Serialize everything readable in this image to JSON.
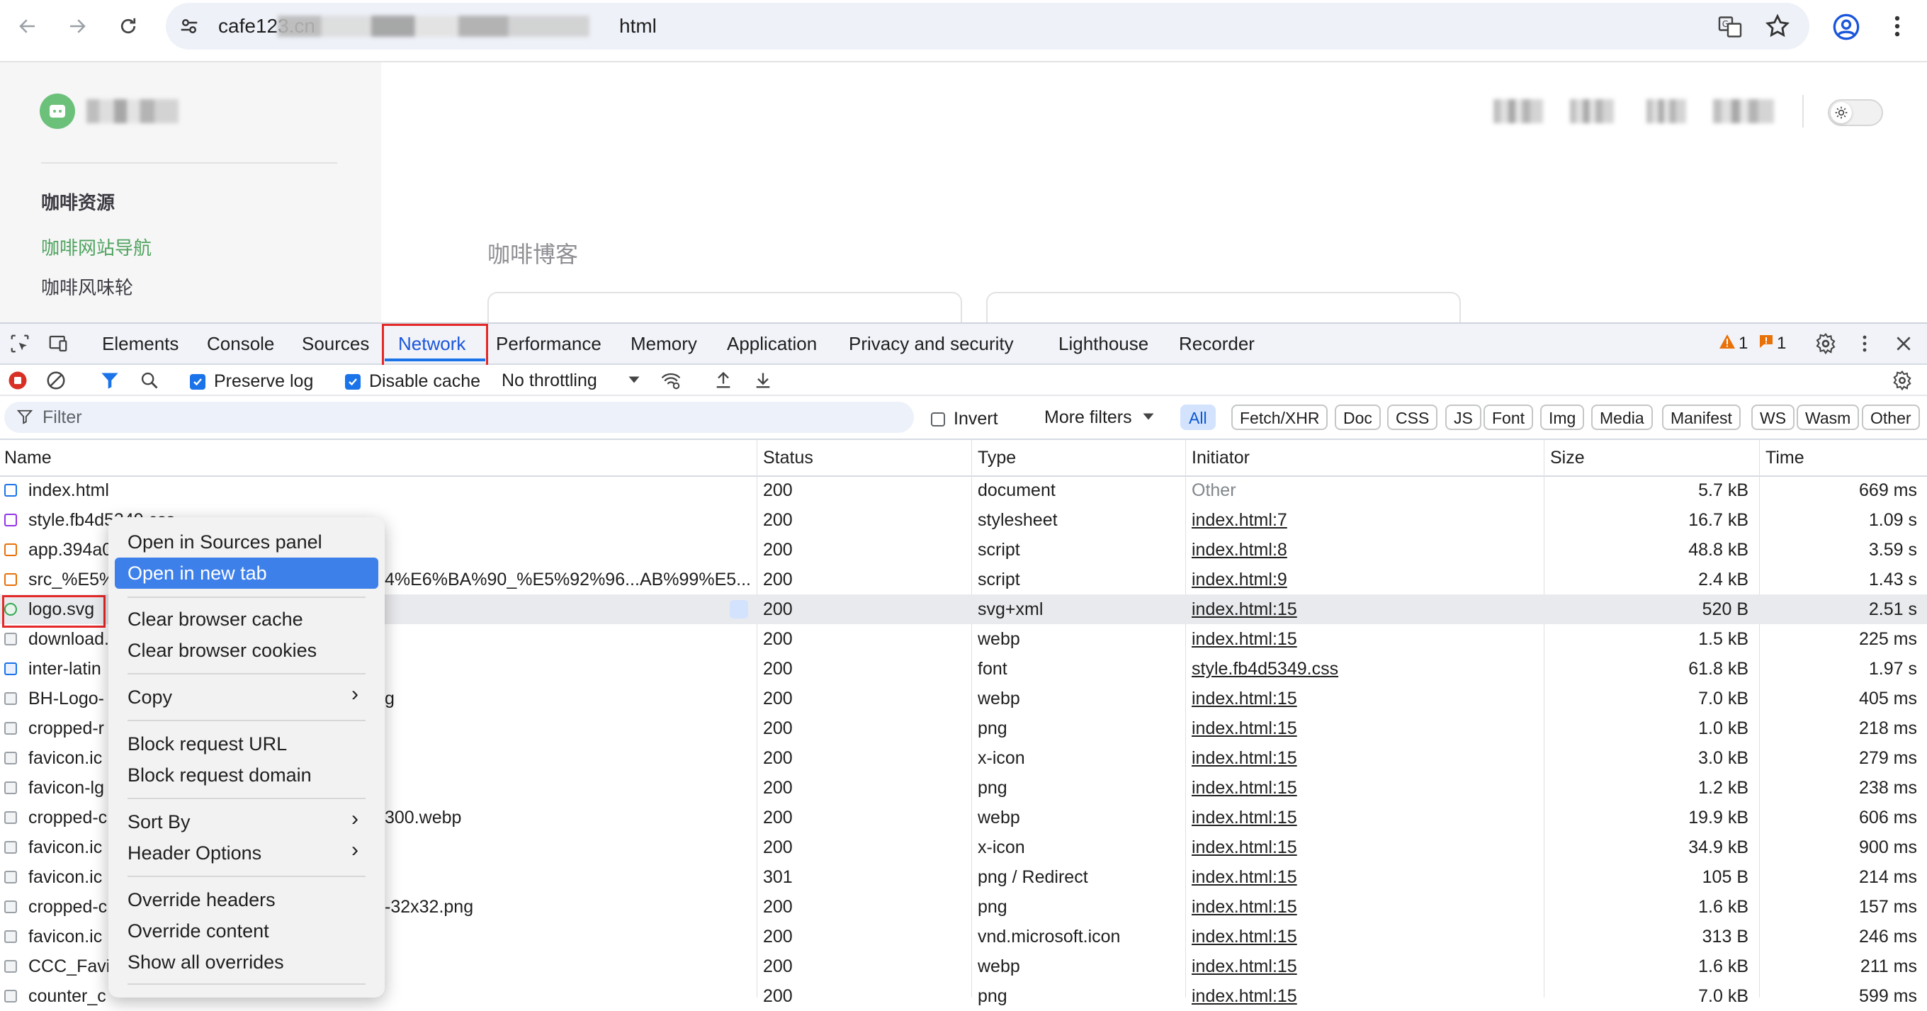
{
  "browser": {
    "url_prefix": "cafe123.cn",
    "url_suffix": "html",
    "icons": [
      "back-icon",
      "forward-icon",
      "reload-icon",
      "site-info-icon",
      "translate-icon",
      "bookmark-star-icon",
      "profile-icon",
      "more-menu-icon"
    ]
  },
  "page": {
    "section_title": "咖啡资源",
    "side_links": [
      "咖啡网站导航",
      "咖啡风味轮"
    ],
    "blog_heading": "咖啡博客"
  },
  "devtools": {
    "tabs": [
      "Elements",
      "Console",
      "Sources",
      "Network",
      "Performance",
      "Memory",
      "Application",
      "Privacy and security",
      "Lighthouse",
      "Recorder"
    ],
    "active_tab": "Network",
    "warning_count": "1",
    "issue_count": "1",
    "toolbar": {
      "preserve_log": "Preserve log",
      "disable_cache": "Disable cache",
      "throttling": "No throttling"
    },
    "filter": {
      "placeholder": "Filter",
      "invert": "Invert",
      "more_filters": "More filters",
      "chips": [
        "All",
        "Fetch/XHR",
        "Doc",
        "CSS",
        "JS",
        "Font",
        "Img",
        "Media",
        "Manifest",
        "WS",
        "Wasm",
        "Other"
      ]
    },
    "columns": [
      "Name",
      "Status",
      "Type",
      "Initiator",
      "Size",
      "Time"
    ],
    "rows": [
      {
        "name": "index.html",
        "status": "200",
        "type": "document",
        "initiator": "Other",
        "size": "5.7 kB",
        "time": "669 ms",
        "icon": "doc",
        "other": true
      },
      {
        "name": "style.fb4d5349.css",
        "status": "200",
        "type": "stylesheet",
        "initiator": "index.html:7",
        "size": "16.7 kB",
        "time": "1.09 s",
        "icon": "css"
      },
      {
        "name": "app.394a0",
        "status": "200",
        "type": "script",
        "initiator": "index.html:8",
        "size": "48.8 kB",
        "time": "3.59 s",
        "icon": "js"
      },
      {
        "name": "src_%E5%",
        "tail": "4%E6%BA%90_%E5%92%96...AB%99%E5...",
        "status": "200",
        "type": "script",
        "initiator": "index.html:9",
        "size": "2.4 kB",
        "time": "1.43 s",
        "icon": "js"
      },
      {
        "name": "logo.svg",
        "status": "200",
        "type": "svg+xml",
        "initiator": "index.html:15",
        "size": "520 B",
        "time": "2.51 s",
        "icon": "svg",
        "highlighted": true
      },
      {
        "name": "download.",
        "status": "200",
        "type": "webp",
        "initiator": "index.html:15",
        "size": "1.5 kB",
        "time": "225 ms",
        "icon": "img"
      },
      {
        "name": "inter-latin",
        "status": "200",
        "type": "font",
        "initiator": "style.fb4d5349.css",
        "size": "61.8 kB",
        "time": "1.97 s",
        "icon": "font"
      },
      {
        "name": "BH-Logo-",
        "tail": "g",
        "status": "200",
        "type": "webp",
        "initiator": "index.html:15",
        "size": "7.0 kB",
        "time": "405 ms",
        "icon": "img"
      },
      {
        "name": "cropped-r",
        "status": "200",
        "type": "png",
        "initiator": "index.html:15",
        "size": "1.0 kB",
        "time": "218 ms",
        "icon": "img"
      },
      {
        "name": "favicon.ic",
        "status": "200",
        "type": "x-icon",
        "initiator": "index.html:15",
        "size": "3.0 kB",
        "time": "279 ms",
        "icon": "img"
      },
      {
        "name": "favicon-lg",
        "status": "200",
        "type": "png",
        "initiator": "index.html:15",
        "size": "1.2 kB",
        "time": "238 ms",
        "icon": "img"
      },
      {
        "name": "cropped-c",
        "tail": "300.webp",
        "status": "200",
        "type": "webp",
        "initiator": "index.html:15",
        "size": "19.9 kB",
        "time": "606 ms",
        "icon": "img"
      },
      {
        "name": "favicon.ic",
        "status": "200",
        "type": "x-icon",
        "initiator": "index.html:15",
        "size": "34.9 kB",
        "time": "900 ms",
        "icon": "img"
      },
      {
        "name": "favicon.ic",
        "status": "301",
        "type": "png / Redirect",
        "initiator": "index.html:15",
        "size": "105 B",
        "time": "214 ms",
        "icon": "img"
      },
      {
        "name": "cropped-c",
        "tail": "-32x32.png",
        "status": "200",
        "type": "png",
        "initiator": "index.html:15",
        "size": "1.6 kB",
        "time": "157 ms",
        "icon": "img"
      },
      {
        "name": "favicon.ic",
        "status": "200",
        "type": "vnd.microsoft.icon",
        "initiator": "index.html:15",
        "size": "313 B",
        "time": "246 ms",
        "icon": "img"
      },
      {
        "name": "CCC_Favi",
        "status": "200",
        "type": "webp",
        "initiator": "index.html:15",
        "size": "1.6 kB",
        "time": "211 ms",
        "icon": "img"
      },
      {
        "name": "counter_c",
        "status": "200",
        "type": "png",
        "initiator": "index.html:15",
        "size": "7.0 kB",
        "time": "599 ms",
        "icon": "img"
      }
    ],
    "context_menu": {
      "groups": [
        [
          "Open in Sources panel",
          "Open in new tab"
        ],
        [
          "Clear browser cache",
          "Clear browser cookies"
        ],
        [
          "Copy"
        ],
        [
          "Block request URL",
          "Block request domain"
        ],
        [
          "Sort By",
          "Header Options"
        ],
        [
          "Override headers",
          "Override content",
          "Show all overrides"
        ]
      ],
      "selected": "Open in new tab",
      "submenus": [
        "Copy",
        "Sort By",
        "Header Options"
      ]
    }
  }
}
